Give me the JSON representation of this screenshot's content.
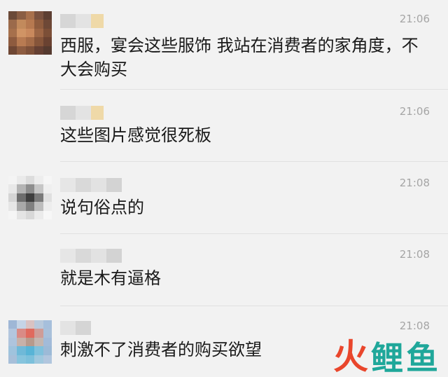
{
  "messages": [
    {
      "id": "m1",
      "time": "21:06",
      "text": "西服，宴会这些服饰 我站在消费者的家角度，不大会购买",
      "has_avatar": true
    },
    {
      "id": "m2",
      "time": "21:06",
      "text": "这些图片感觉很死板",
      "has_avatar": false
    },
    {
      "id": "m3",
      "time": "21:08",
      "text": "说句俗点的",
      "has_avatar": true
    },
    {
      "id": "m4",
      "time": "21:08",
      "text": "就是木有逼格",
      "has_avatar": false
    },
    {
      "id": "m5",
      "time": "21:08",
      "text": "刺激不了消费者的购买欲望",
      "has_avatar": true
    }
  ],
  "watermark": {
    "char1": "火",
    "char2": "鲤",
    "char3": "鱼"
  },
  "colors": {
    "background": "#f2f2f2",
    "time": "#a5a5a5",
    "divider": "#e1e1e1",
    "watermark_red": "#e9462c",
    "watermark_teal": "#1fa79a"
  }
}
